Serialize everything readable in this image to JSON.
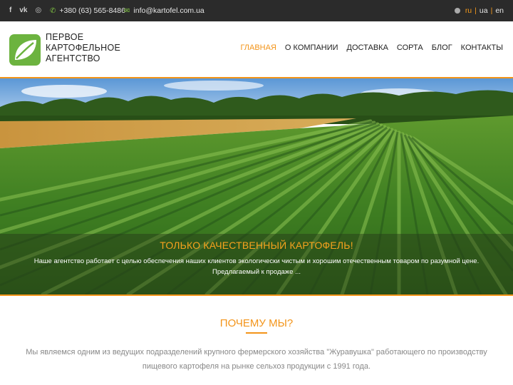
{
  "topbar": {
    "social": [
      {
        "name": "facebook-icon",
        "glyph": "f"
      },
      {
        "name": "vk-icon",
        "glyph": "vk"
      },
      {
        "name": "instagram-icon",
        "glyph": "◎"
      }
    ],
    "phone_icon": "phone-icon",
    "phone": "+380 (63) 565-8486",
    "email_icon": "mail-icon",
    "email": "info@kartofel.com.ua",
    "languages": [
      {
        "label": "ru",
        "active": true
      },
      {
        "label": "ua",
        "active": false
      },
      {
        "label": "en",
        "active": false
      }
    ],
    "lang_separator": "|"
  },
  "header": {
    "logo_lines": [
      "ПЕРВОЕ",
      "КАРТОФЕЛЬНОЕ",
      "АГЕНТСТВО"
    ],
    "nav": [
      {
        "label": "ГЛАВНАЯ",
        "active": true
      },
      {
        "label": "О КОМПАНИИ",
        "active": false
      },
      {
        "label": "ДОСТАВКА",
        "active": false
      },
      {
        "label": "СОРТА",
        "active": false
      },
      {
        "label": "БЛОГ",
        "active": false
      },
      {
        "label": "КОНТАКТЫ",
        "active": false
      }
    ]
  },
  "hero": {
    "title": "ТОЛЬКО КАЧЕСТВЕННЫЙ КАРТОФЕЛЬ!",
    "text_line1": "Наше агентство работает с целью обеспечения наших клиентов экологически чистым и хорошим отечественным товаром по разумной цене.",
    "text_line2": "Предлагаемый к продаже ..."
  },
  "why": {
    "title": "ПОЧЕМУ МЫ?",
    "text_line1": "Мы являемся одним из ведущих подразделений крупного фермерского хозяйства \"Журавушка\" работающего по производству",
    "text_line2": "пищевого картофеля на рынке сельхоз продукции с 1991 года."
  },
  "colors": {
    "accent": "#f39419",
    "brand_green": "#6cb33f",
    "topbar_bg": "#2b2b2b",
    "icon_green": "#7fc242"
  }
}
